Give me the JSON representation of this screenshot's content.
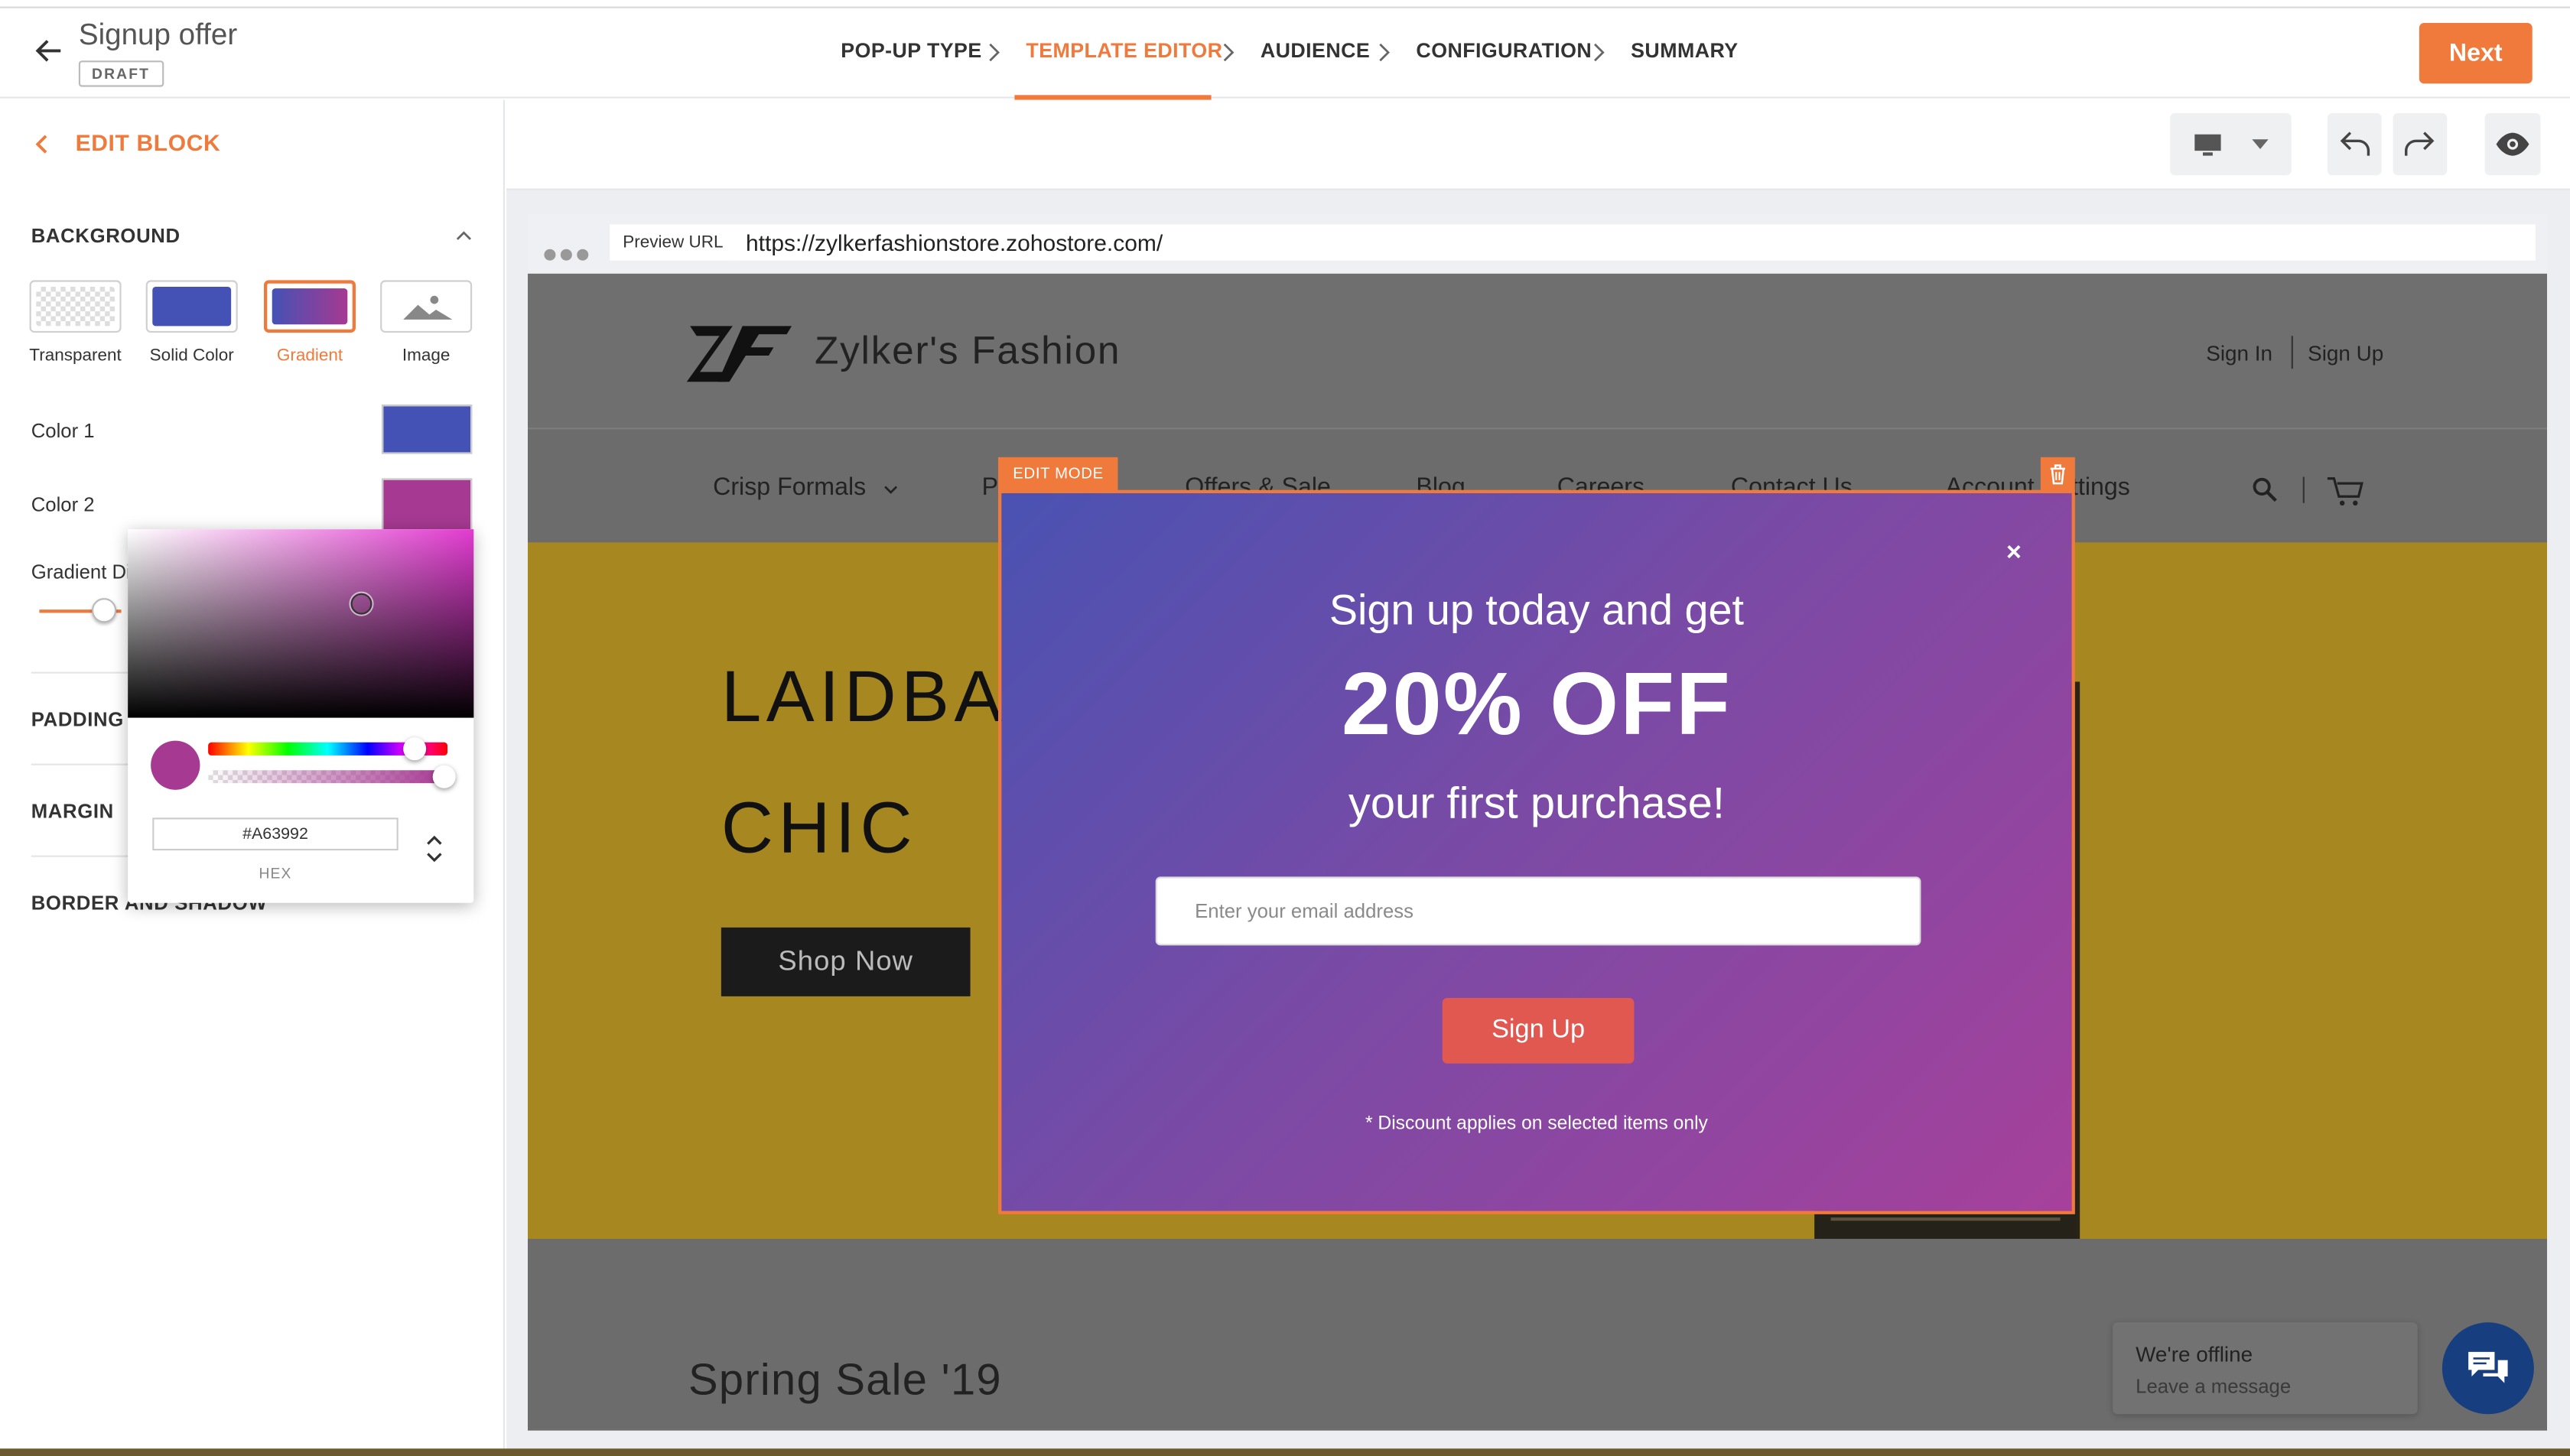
{
  "app": {
    "title": "Signup offer",
    "status": "DRAFT",
    "steps": [
      "POP-UP TYPE",
      "TEMPLATE EDITOR",
      "AUDIENCE",
      "CONFIGURATION",
      "SUMMARY"
    ],
    "active_step": "TEMPLATE EDITOR",
    "next_label": "Next",
    "accent_color": "#EF7A3C"
  },
  "sidebar": {
    "header": "EDIT BLOCK",
    "background_section": "BACKGROUND",
    "background_options": [
      "Transparent",
      "Solid Color",
      "Gradient",
      "Image"
    ],
    "selected_background": "Gradient",
    "color1_label": "Color 1",
    "color1_value": "#4452B5",
    "color2_label": "Color 2",
    "color2_value": "#A63992",
    "gradient_direction_label": "Gradient Di",
    "padding_label": "PADDING",
    "margin_label": "MARGIN",
    "border_label": "BORDER AND SHADOW",
    "picker": {
      "hex_value": "#A63992",
      "hex_label": "HEX"
    }
  },
  "preview": {
    "url_label": "Preview URL",
    "url": "https://zylkerfashionstore.zohostore.com/",
    "site": {
      "brand": "Zylker's Fashion",
      "sign_in": "Sign In",
      "sign_up": "Sign Up",
      "nav": [
        "Crisp Formals",
        "P",
        "Offers & Sale",
        "Blog",
        "Careers",
        "Contact Us",
        "Account Settings"
      ],
      "hero_line1": "LAIDBAC",
      "hero_line2": "CHIC",
      "shop_now": "Shop Now",
      "section_title": "Spring Sale '19",
      "chat_status": "We're offline",
      "chat_action": "Leave a message"
    },
    "popup": {
      "edit_mode_label": "EDIT MODE",
      "line1": "Sign up today and get",
      "line2": "20% OFF",
      "line3": "your first purchase!",
      "email_placeholder": "Enter your email address",
      "button_label": "Sign Up",
      "note": "* Discount applies on selected items only",
      "close_symbol": "×"
    }
  }
}
